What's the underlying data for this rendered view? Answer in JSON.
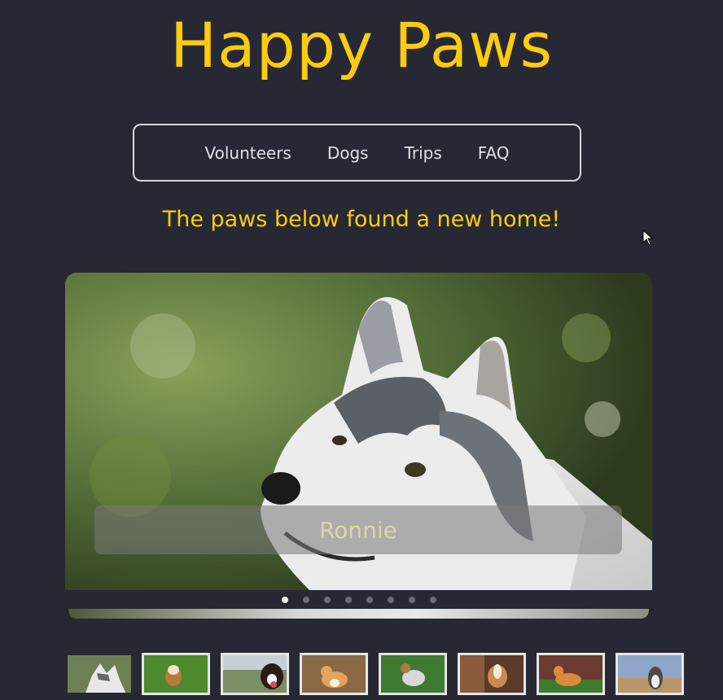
{
  "header": {
    "title": "Happy Paws"
  },
  "nav": {
    "items": [
      {
        "label": "Volunteers"
      },
      {
        "label": "Dogs"
      },
      {
        "label": "Trips"
      },
      {
        "label": "FAQ"
      }
    ]
  },
  "tagline": "The paws below found a new home!",
  "carousel": {
    "caption": "Ronnie",
    "slide_count": 8,
    "active_index": 0
  },
  "thumbnails": [
    {
      "dog": "husky-icon"
    },
    {
      "dog": "beagle-icon"
    },
    {
      "dog": "bernese-icon"
    },
    {
      "dog": "corgi-icon"
    },
    {
      "dog": "husky-icon"
    },
    {
      "dog": "beagle-icon"
    },
    {
      "dog": "corgi-icon"
    },
    {
      "dog": "husky-icon"
    }
  ],
  "colors": {
    "background": "#262933",
    "accent": "#ffcc0d",
    "nav_text": "#dfe0e4"
  }
}
